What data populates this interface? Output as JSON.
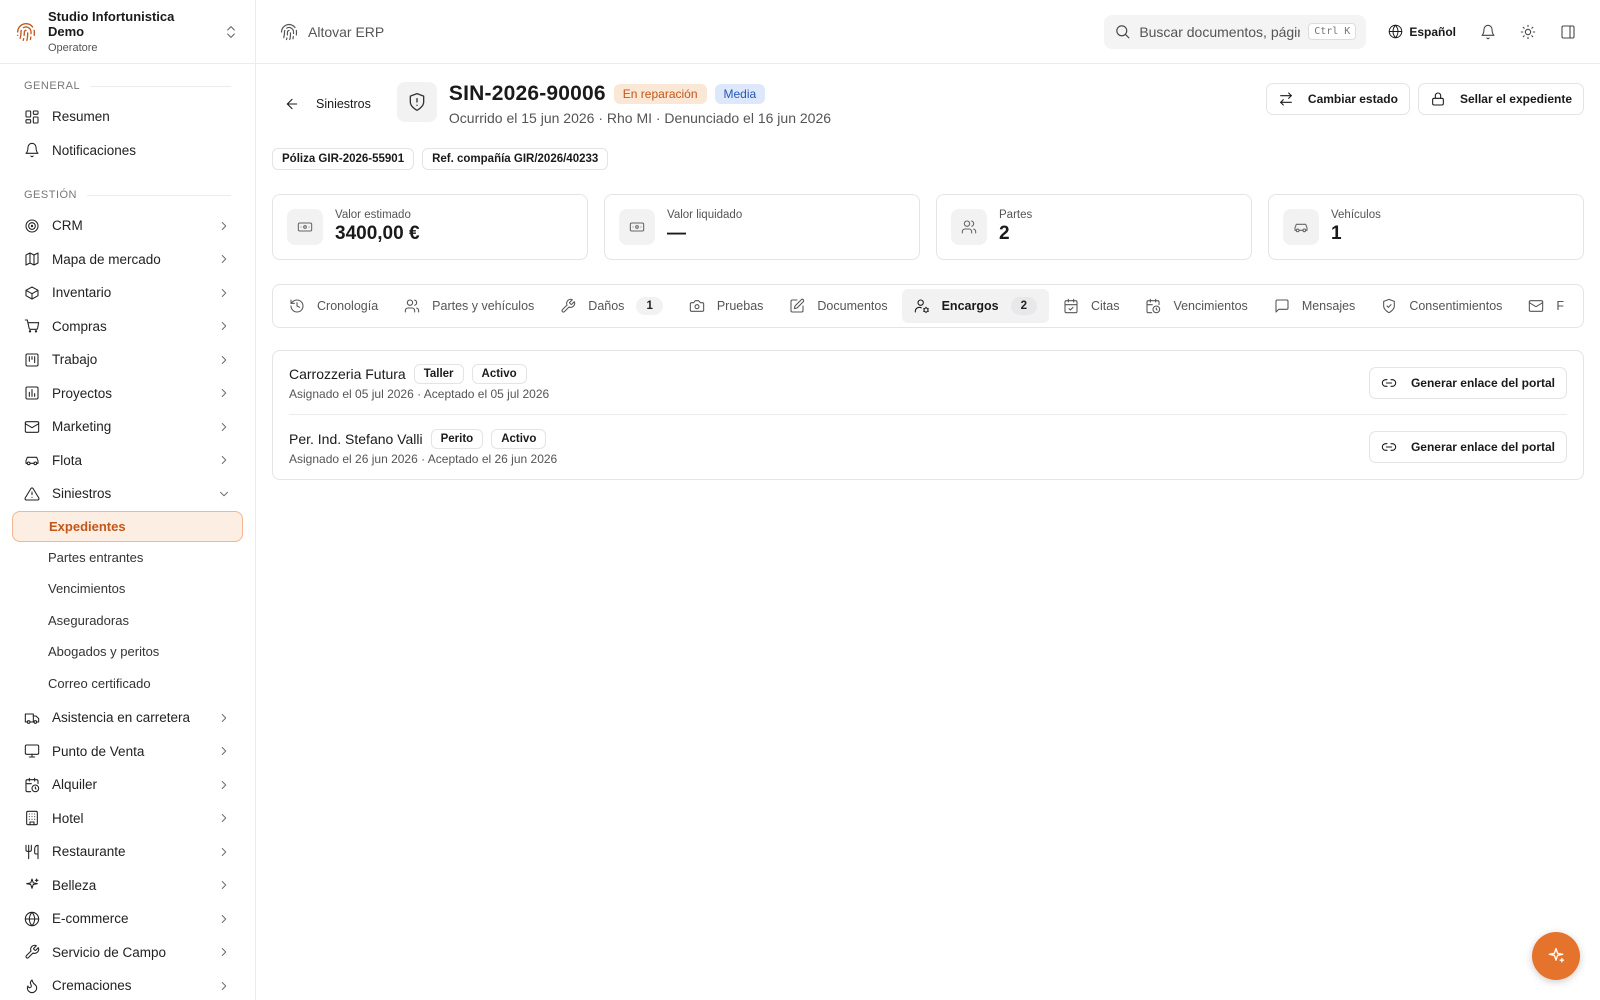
{
  "org": {
    "name": "Studio Infortunistica Demo",
    "role": "Operatore"
  },
  "sidebar": {
    "section_general": "GENERAL",
    "general": [
      {
        "label": "Resumen",
        "icon": "grid-icon"
      },
      {
        "label": "Notificaciones",
        "icon": "bell-icon"
      }
    ],
    "section_management": "GESTIÓN",
    "management": [
      {
        "label": "CRM",
        "icon": "target-icon"
      },
      {
        "label": "Mapa de mercado",
        "icon": "map-icon"
      },
      {
        "label": "Inventario",
        "icon": "box-icon"
      },
      {
        "label": "Compras",
        "icon": "cart-icon"
      },
      {
        "label": "Trabajo",
        "icon": "kanban-icon"
      },
      {
        "label": "Proyectos",
        "icon": "chart-icon"
      },
      {
        "label": "Marketing",
        "icon": "mail-icon"
      },
      {
        "label": "Flota",
        "icon": "car-icon"
      },
      {
        "label": "Siniestros",
        "icon": "warning-icon"
      }
    ],
    "siniestros_sub": [
      "Expedientes",
      "Partes entrantes",
      "Vencimientos",
      "Aseguradoras",
      "Abogados y peritos",
      "Correo certificado"
    ],
    "more": [
      {
        "label": "Asistencia en carretera",
        "icon": "truck-icon"
      },
      {
        "label": "Punto de Venta",
        "icon": "monitor-icon"
      },
      {
        "label": "Alquiler",
        "icon": "calendar-clock-icon"
      },
      {
        "label": "Hotel",
        "icon": "building-icon"
      },
      {
        "label": "Restaurante",
        "icon": "utensils-icon"
      },
      {
        "label": "Belleza",
        "icon": "sparkles-icon"
      },
      {
        "label": "E-commerce",
        "icon": "globe-icon"
      },
      {
        "label": "Servicio de Campo",
        "icon": "wrench-icon"
      },
      {
        "label": "Cremaciones",
        "icon": "flame-icon"
      }
    ]
  },
  "topbar": {
    "brand": "Altovar ERP",
    "search_placeholder": "Buscar documentos, páginas...",
    "shortcut": "Ctrl K",
    "language": "Español"
  },
  "claim": {
    "back_label": "Siniestros",
    "id": "SIN-2026-90006",
    "status": "En reparación",
    "priority": "Media",
    "subtitle": "Ocurrido el 15 jun 2026 · Rho MI · Denunciado el 16 jun 2026",
    "btn_change_status": "Cambiar estado",
    "btn_seal": "Sellar el expediente",
    "policy_chip": "Póliza GIR-2026-55901",
    "ref_chip": "Ref. compañía GIR/2026/40233"
  },
  "stats": [
    {
      "label": "Valor estimado",
      "value": "3400,00 €",
      "icon": "banknote-icon"
    },
    {
      "label": "Valor liquidado",
      "value": "—",
      "icon": "banknote-icon"
    },
    {
      "label": "Partes",
      "value": "2",
      "icon": "users-icon"
    },
    {
      "label": "Vehículos",
      "value": "1",
      "icon": "car-icon"
    }
  ],
  "tabs": [
    {
      "label": "Cronología",
      "icon": "history-icon",
      "count": ""
    },
    {
      "label": "Partes y vehículos",
      "icon": "users-icon",
      "count": ""
    },
    {
      "label": "Daños",
      "icon": "wrench-icon",
      "count": "1"
    },
    {
      "label": "Pruebas",
      "icon": "camera-icon",
      "count": ""
    },
    {
      "label": "Documentos",
      "icon": "edit-doc-icon",
      "count": ""
    },
    {
      "label": "Encargos",
      "icon": "user-cog-icon",
      "count": "2"
    },
    {
      "label": "Citas",
      "icon": "calendar-icon",
      "count": ""
    },
    {
      "label": "Vencimientos",
      "icon": "calendar-clock-icon",
      "count": ""
    },
    {
      "label": "Mensajes",
      "icon": "message-icon",
      "count": ""
    },
    {
      "label": "Consentimientos",
      "icon": "shield-check-icon",
      "count": ""
    },
    {
      "label": "F",
      "icon": "mail-icon",
      "count": ""
    }
  ],
  "assignments": [
    {
      "name": "Carrozzeria Futura",
      "role": "Taller",
      "state": "Activo",
      "dates": "Asignado el 05 jul 2026 · Aceptado el 05 jul 2026",
      "action": "Generar enlace del portal"
    },
    {
      "name": "Per. Ind. Stefano Valli",
      "role": "Perito",
      "state": "Activo",
      "dates": "Asignado el 26 jun 2026 · Aceptado el 26 jun 2026",
      "action": "Generar enlace del portal"
    }
  ],
  "colors": {
    "accent": "#c2571a",
    "fab": "#e5732b",
    "priority": "#2757b5"
  }
}
